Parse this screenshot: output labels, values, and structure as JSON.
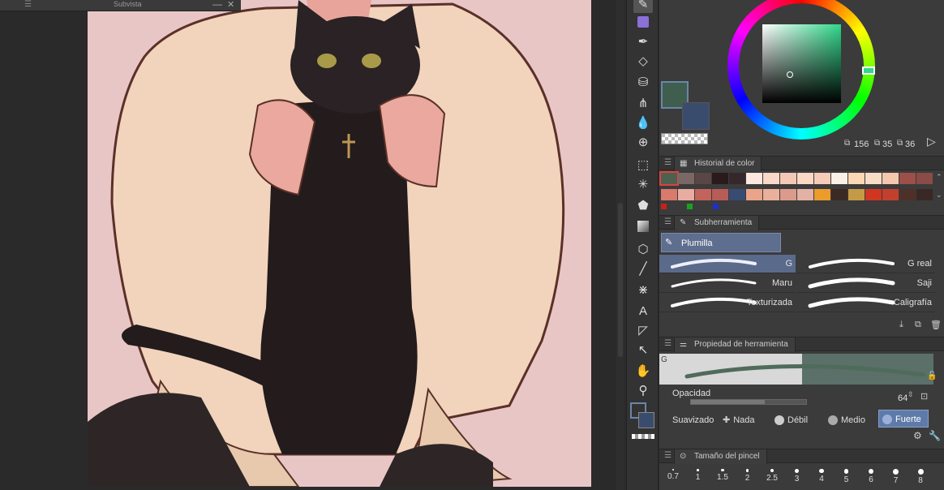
{
  "subview": {
    "menu_icon": "hamburger-icon",
    "title": "Subvista",
    "minimize": "—",
    "close": "✕"
  },
  "color": {
    "main": "#3f5e4e",
    "sub": "#3a4c6e",
    "h": "156",
    "s": "35",
    "v": "36",
    "accent": "#6a86a8"
  },
  "history": {
    "title": "Historial de color",
    "row1": [
      "#4d6150",
      "#7a6864",
      "#5a4644",
      "#2a1a1c",
      "#36282a",
      "#fde7de",
      "#f9d8ca",
      "#f5c8b5",
      "#fad9c5",
      "#f6cbb7",
      "#fcf1e7",
      "#fbd7b3",
      "#f9dcc6",
      "#f3c8ae",
      "#9c5048",
      "#8b4b46"
    ],
    "row2": [
      "#d87a6c",
      "#e8ada0",
      "#c3645c",
      "#b85c58",
      "#384b72",
      "#e9a489",
      "#eab09a",
      "#dc9a8c",
      "#e3b2a4",
      "#eb9c2a",
      "#3b2a24",
      "#c59a46",
      "#d03622",
      "#c1402e",
      "#4f3028",
      "#3a2824"
    ],
    "mini": [
      "#c8211b",
      "#18a31e",
      "#1f2ed0"
    ]
  },
  "subtool": {
    "title": "Subherramienta",
    "group": "Plumilla",
    "brushes": [
      "G",
      "G real",
      "Maru",
      "Saji",
      "Texturizada",
      "Caligrafía"
    ]
  },
  "toolprop": {
    "title": "Propiedad de herramienta",
    "brush_name": "G",
    "opacity_label": "Opacidad",
    "opacity_value": "64",
    "opacity_fraction": 0.64,
    "smooth_label": "Suavizado",
    "smooth_options": [
      "Nada",
      "Débil",
      "Medio",
      "Fuerte"
    ],
    "smooth_selected": 3
  },
  "brushsize": {
    "title": "Tamaño del pincel",
    "sizes": [
      "0.7",
      "1",
      "1.5",
      "2",
      "2.5",
      "3",
      "4",
      "5",
      "6",
      "7",
      "8"
    ]
  }
}
